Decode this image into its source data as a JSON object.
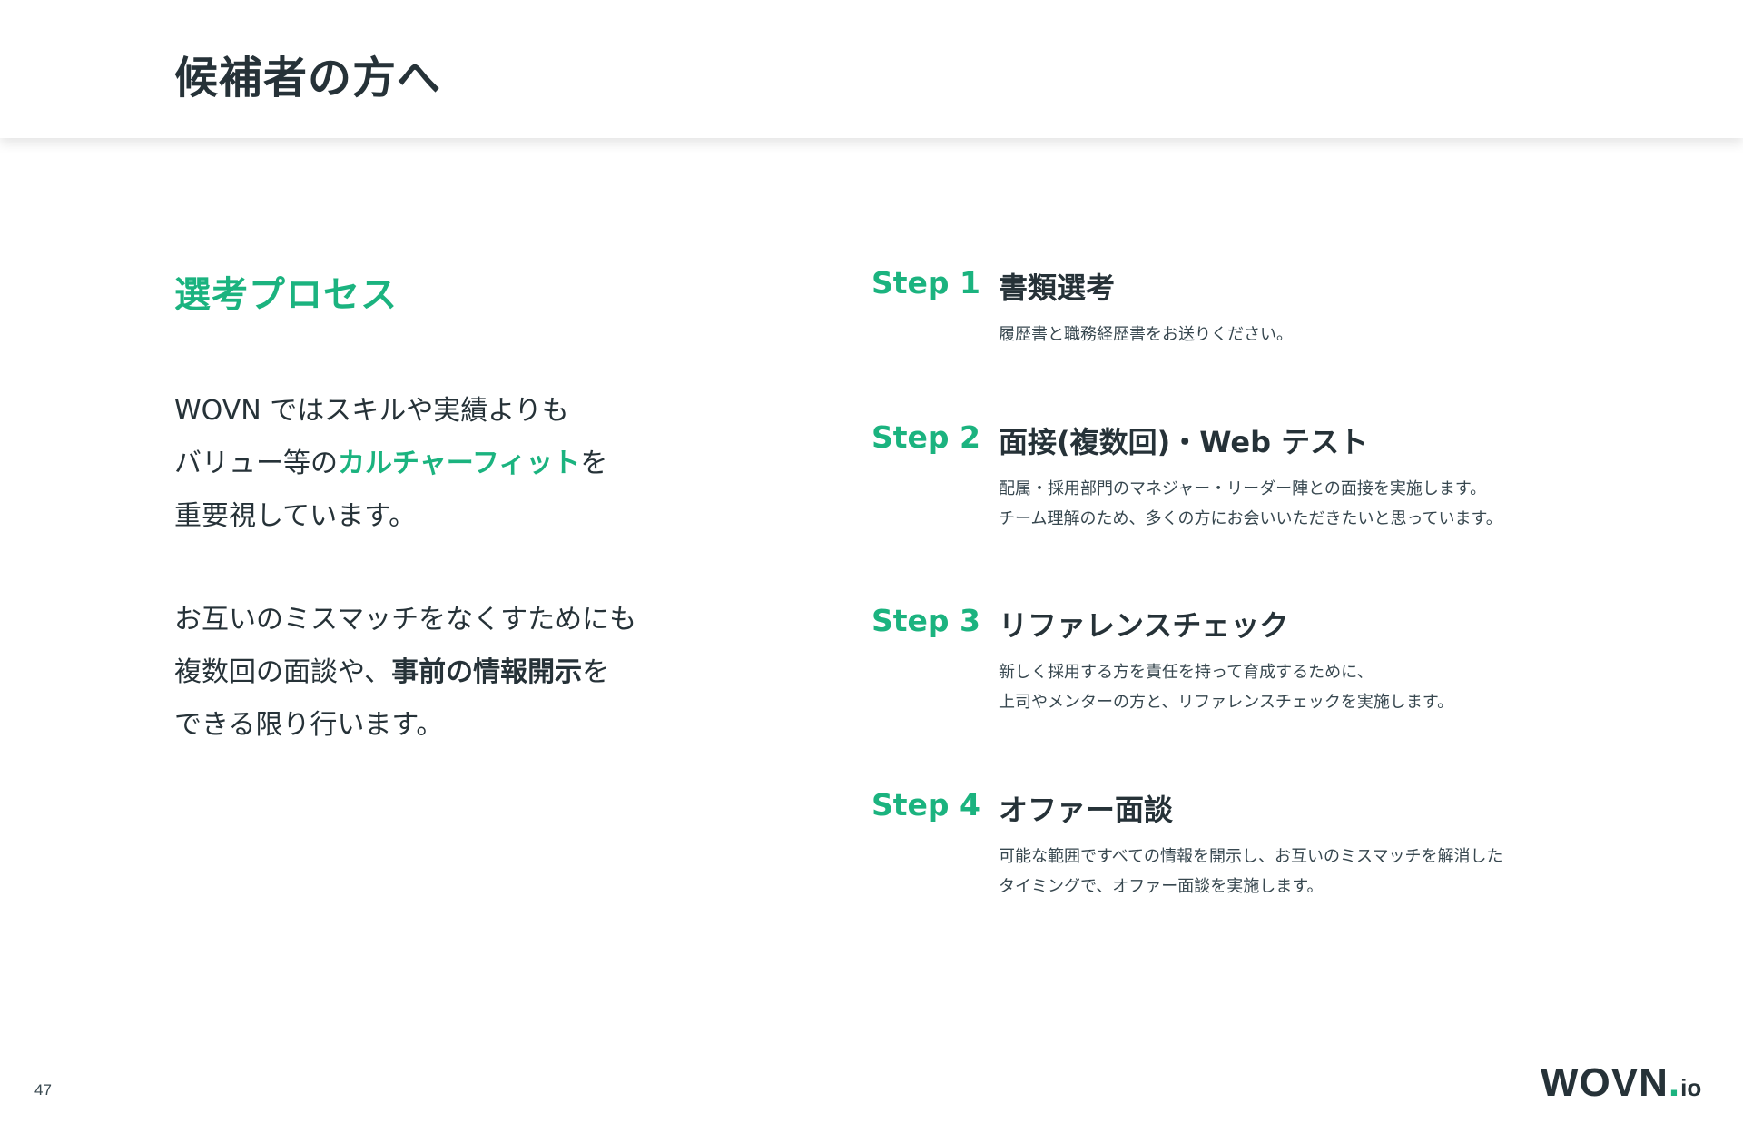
{
  "page_title": "候補者の方へ",
  "accent_color": "#1bb37f",
  "left": {
    "section_title": "選考プロセス",
    "paragraph1": {
      "line1": "WOVN ではスキルや実績よりも",
      "line2_pre": "バリュー等の",
      "line2_highlight": "カルチャーフィット",
      "line2_post": "を",
      "line3": "重要視しています。"
    },
    "paragraph2": {
      "line1": "お互いのミスマッチをなくすためにも",
      "line2_pre": "複数回の面談や、",
      "line2_bold": "事前の情報開示",
      "line2_post": "を",
      "line3": "できる限り行います。"
    }
  },
  "steps": [
    {
      "label": "Step 1",
      "title": "書類選考",
      "desc": [
        "履歴書と職務経歴書をお送りください。"
      ]
    },
    {
      "label": "Step 2",
      "title": "面接(複数回)・Web テスト",
      "desc": [
        "配属・採用部門のマネジャー・リーダー陣との面接を実施します。",
        "チーム理解のため、多くの方にお会いいただきたいと思っています。"
      ]
    },
    {
      "label": "Step 3",
      "title": "リファレンスチェック",
      "desc": [
        "新しく採用する方を責任を持って育成するために、",
        "上司やメンターの方と、リファレンスチェックを実施します。"
      ]
    },
    {
      "label": "Step 4",
      "title": "オファー面談",
      "desc": [
        "可能な範囲ですべての情報を開示し、お互いのミスマッチを解消した",
        "タイミングで、オファー面談を実施します。"
      ]
    }
  ],
  "footer": {
    "page_number": "47",
    "logo_main": "WOVN",
    "logo_dot": ".",
    "logo_suffix": "io"
  }
}
